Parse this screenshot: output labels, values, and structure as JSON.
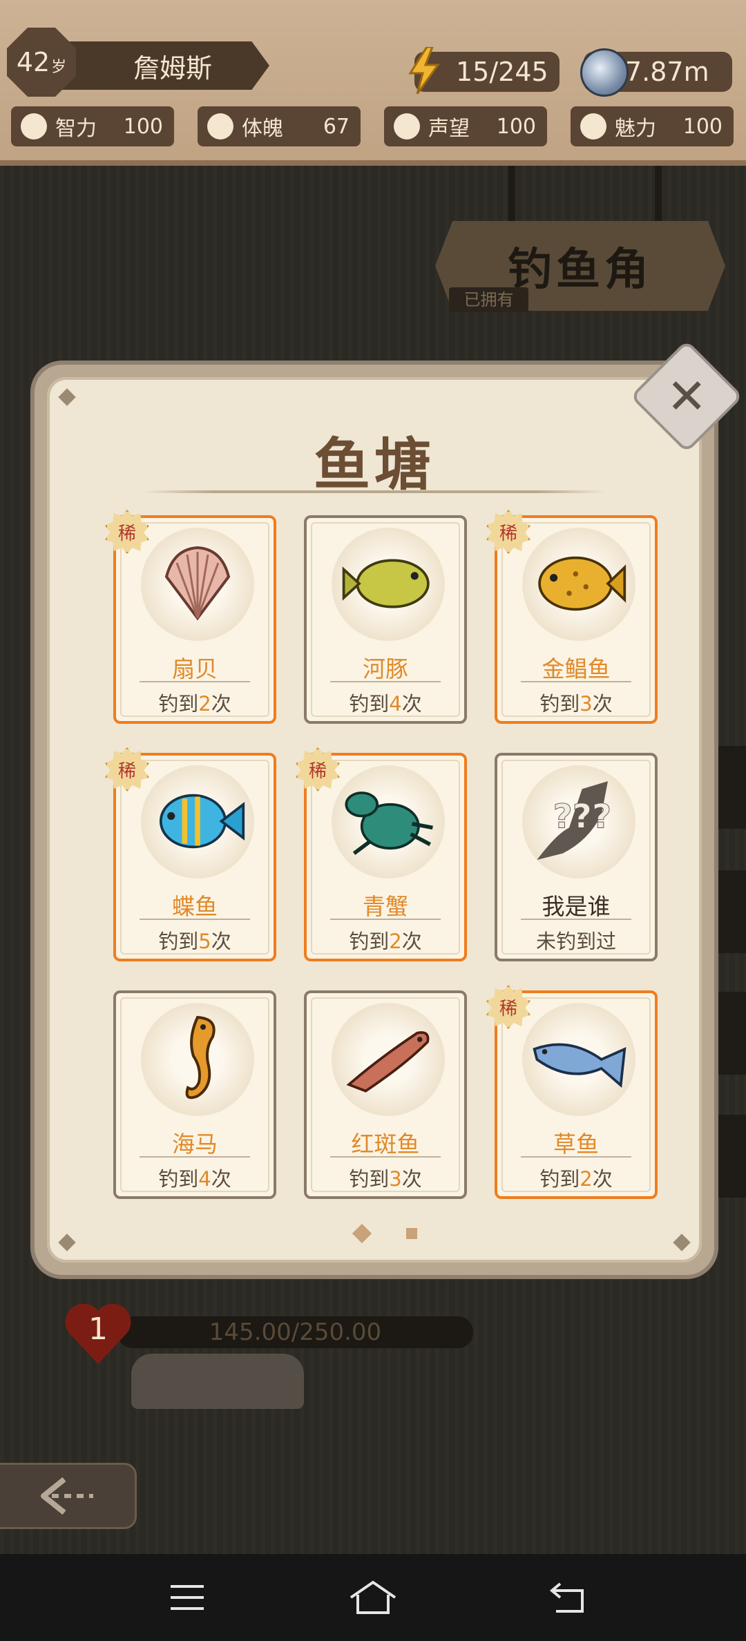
{
  "header": {
    "age": "42",
    "age_unit": "岁",
    "player_name": "詹姆斯",
    "energy": "15/245",
    "coins": "7.87m",
    "stats": [
      {
        "label": "智力",
        "value": "100",
        "icon": "brain-icon"
      },
      {
        "label": "体魄",
        "value": "67",
        "icon": "muscle-icon"
      },
      {
        "label": "声望",
        "value": "100",
        "icon": "crossed-tools-icon"
      },
      {
        "label": "魅力",
        "value": "100",
        "icon": "heartbeat-icon"
      }
    ]
  },
  "location": {
    "title": "钓鱼角",
    "owned_label": "已拥有"
  },
  "modal": {
    "title": "鱼塘",
    "close_icon": "close-icon",
    "rare_badge": "稀",
    "caught_prefix": "钓到",
    "caught_suffix": "次",
    "fish": [
      {
        "name": "扇贝",
        "count": "2",
        "rare": true,
        "icon": "scallop-icon"
      },
      {
        "name": "河豚",
        "count": "4",
        "rare": false,
        "icon": "pufferfish-icon"
      },
      {
        "name": "金鲳鱼",
        "count": "3",
        "rare": true,
        "icon": "golden-pomfret-icon"
      },
      {
        "name": "蝶鱼",
        "count": "5",
        "rare": true,
        "icon": "angelfish-icon"
      },
      {
        "name": "青蟹",
        "count": "2",
        "rare": true,
        "icon": "crab-icon"
      },
      {
        "name": "我是谁",
        "status": "未钓到过",
        "rare": false,
        "icon": "unknown-fish-icon",
        "unknown_text": "???"
      },
      {
        "name": "海马",
        "count": "4",
        "rare": false,
        "icon": "seahorse-icon"
      },
      {
        "name": "红斑鱼",
        "count": "3",
        "rare": false,
        "icon": "spotted-fish-icon"
      },
      {
        "name": "草鱼",
        "count": "2",
        "rare": true,
        "icon": "grass-carp-icon"
      }
    ],
    "pagination": {
      "current": 1,
      "total": 2
    }
  },
  "health": {
    "level": "1",
    "text": "145.00/250.00"
  },
  "colors": {
    "rare_border": "#ef7d1e",
    "name_orange": "#e08a2a",
    "panel_bg": "#efe6d4"
  }
}
